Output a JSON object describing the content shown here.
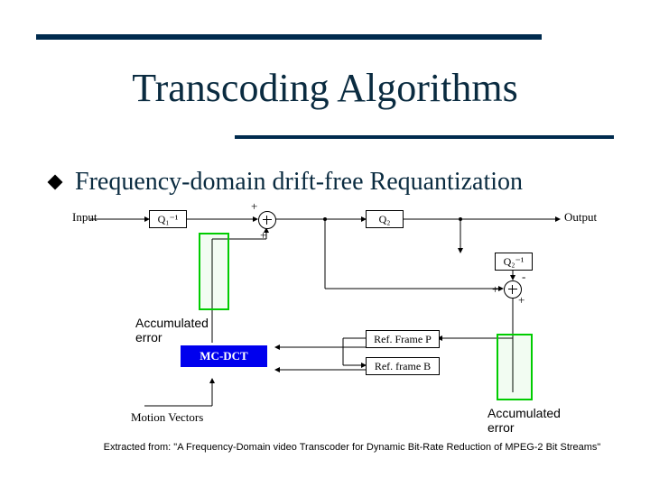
{
  "title": "Transcoding Algorithms",
  "bullet": "Frequency-domain drift-free Requantization",
  "labels": {
    "input": "Input",
    "output": "Output",
    "q1inv": "Q₁⁻¹",
    "q2": "Q₂",
    "q2inv": "Q₂⁻¹",
    "refP": "Ref. Frame P",
    "refB": "Ref. frame B",
    "mcdct": "MC-DCT",
    "mv": "Motion Vectors",
    "plus": "+",
    "minus": "-"
  },
  "annotations": {
    "accum1": "Accumulated error",
    "accum2": "Accumulated error"
  },
  "citation": "Extracted from: \"A Frequency-Domain video Transcoder for Dynamic Bit-Rate Reduction of MPEG-2 Bit Streams\""
}
